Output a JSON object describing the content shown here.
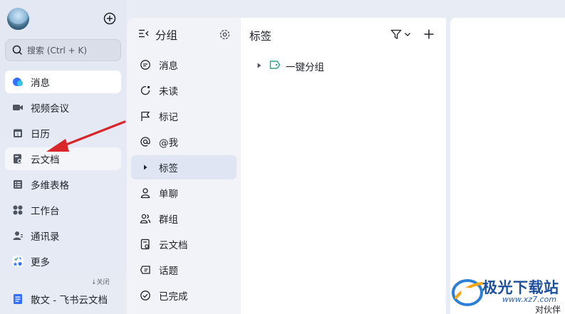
{
  "nav": {
    "search_placeholder": "搜索 (Ctrl + K)",
    "items": [
      {
        "label": "消息",
        "icon": "message-bubble-icon",
        "state": "active"
      },
      {
        "label": "视频会议",
        "icon": "video-camera-icon",
        "state": "normal"
      },
      {
        "label": "日历",
        "icon": "calendar-icon",
        "state": "normal"
      },
      {
        "label": "云文档",
        "icon": "cloud-doc-icon",
        "state": "hover"
      },
      {
        "label": "多维表格",
        "icon": "table-icon",
        "state": "normal"
      },
      {
        "label": "工作台",
        "icon": "workspace-grid-icon",
        "state": "normal"
      },
      {
        "label": "通讯录",
        "icon": "contacts-icon",
        "state": "normal"
      },
      {
        "label": "更多",
        "icon": "more-apps-icon",
        "state": "normal"
      }
    ],
    "collapse_label": "关闭",
    "pinned_doc": "散文 - 飞书云文档"
  },
  "groups": {
    "title": "分组",
    "items": [
      {
        "label": "消息",
        "icon": "chat-icon"
      },
      {
        "label": "未读",
        "icon": "unread-icon"
      },
      {
        "label": "标记",
        "icon": "flag-icon"
      },
      {
        "label": "@我",
        "icon": "at-icon"
      },
      {
        "label": "标签",
        "icon": "caret-right-icon"
      },
      {
        "label": "单聊",
        "icon": "person-icon"
      },
      {
        "label": "群组",
        "icon": "group-icon"
      },
      {
        "label": "云文档",
        "icon": "doc-icon"
      },
      {
        "label": "话题",
        "icon": "topic-icon"
      },
      {
        "label": "已完成",
        "icon": "check-circle-icon"
      }
    ]
  },
  "tags_panel": {
    "title": "标签",
    "tag_items": [
      {
        "label": "一键分组"
      }
    ]
  },
  "watermark": {
    "name": "极光下载站",
    "url": "www.xz7.com",
    "extra": "对伙伴"
  },
  "colors": {
    "accent": "#3370ff",
    "tag_green": "#2ea28a",
    "arrow_red": "#d9262b"
  }
}
